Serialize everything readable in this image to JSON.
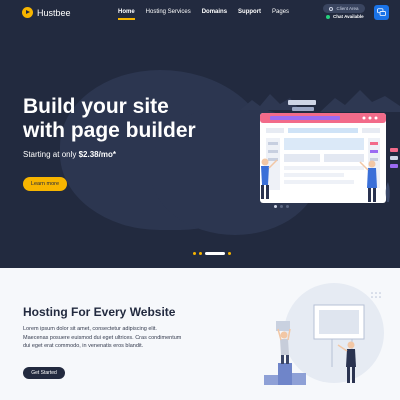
{
  "brand": {
    "name": "Hustbee"
  },
  "nav": {
    "items": [
      {
        "label": "Home"
      },
      {
        "label": "Hosting Services"
      },
      {
        "label": "Domains"
      },
      {
        "label": "Support"
      },
      {
        "label": "Pages"
      }
    ],
    "active_index": 0
  },
  "header": {
    "client_area": "Client Area",
    "chat_status": "Chat Available",
    "chat_icon": "chat-bubbles-icon",
    "status_color": "#26d07c"
  },
  "hero": {
    "title_line1": "Build your site",
    "title_line2": "with page builder",
    "subtitle_prefix": "Starting at only ",
    "subtitle_price": "$2.38/mo*",
    "cta_label": "Learn more"
  },
  "section": {
    "title": "Hosting For Every Website",
    "body": "Lorem ipsum dolor sit amet, consectetur adipiscing elit. Maecenas posuere euismod dui eget ultrices. Cras condimentum dui eget erat commodo, in venenatis eros blandit.",
    "cta_label": "Get Started"
  },
  "colors": {
    "hero_bg": "#222a3f",
    "accent": "#f7b500",
    "chat_button": "#1a73e8",
    "section_bg": "#f6f8fb"
  }
}
